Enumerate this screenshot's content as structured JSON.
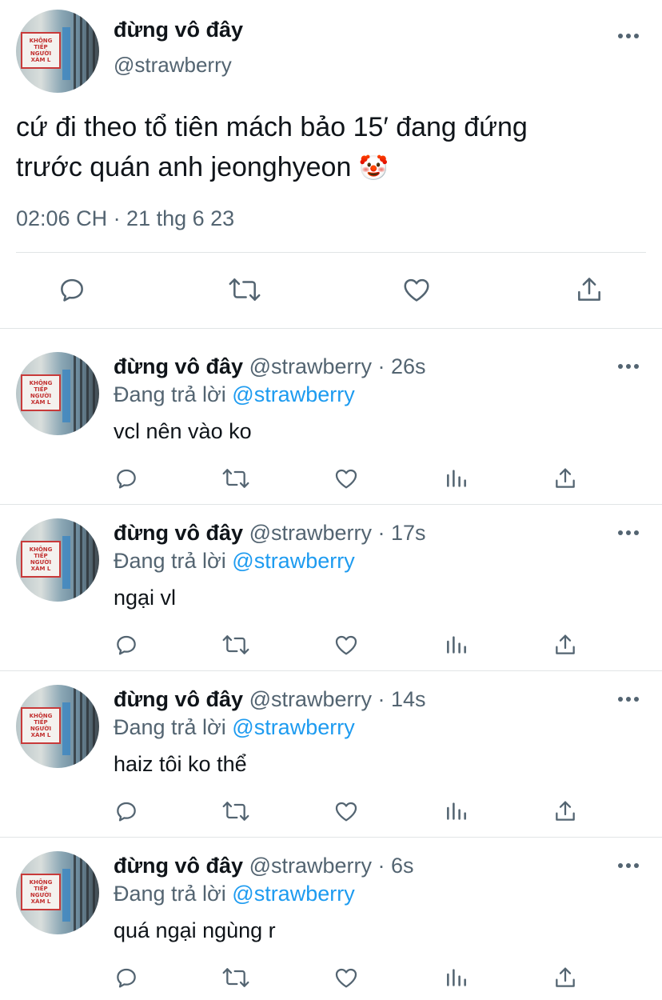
{
  "main_tweet": {
    "display_name": "đừng vô đây",
    "handle": "@strawberry",
    "text_line1": "cứ đi theo tổ tiên mách bảo 15′ đang đứng",
    "text_line2": "trước quán anh jeonghyeon",
    "emoji": "🤡",
    "timestamp": "02:06 CH · 21 thg 6 23",
    "avatar_sign_line1": "KHÔNG TIẾP",
    "avatar_sign_line2": "NGƯỜI XÀM L"
  },
  "reply_prefix": "Đang trả lời",
  "reply_to_handle": "@strawberry",
  "replies": [
    {
      "display_name": "đừng vô đây",
      "handle_time": "@strawberry · 26s",
      "text": "vcl nên vào ko"
    },
    {
      "display_name": "đừng vô đây",
      "handle_time": "@strawberry · 17s",
      "text": "ngại vl"
    },
    {
      "display_name": "đừng vô đây",
      "handle_time": "@strawberry · 14s",
      "text": "haiz tôi ko thể"
    },
    {
      "display_name": "đừng vô đây",
      "handle_time": "@strawberry · 6s",
      "text": "quá ngại ngùng r"
    }
  ],
  "colors": {
    "text": "#0f1419",
    "secondary": "#536471",
    "link": "#1d9bf0",
    "divider": "#e1e4e6"
  },
  "icons": [
    "more-icon",
    "reply-icon",
    "retweet-icon",
    "like-icon",
    "share-icon",
    "analytics-icon"
  ]
}
